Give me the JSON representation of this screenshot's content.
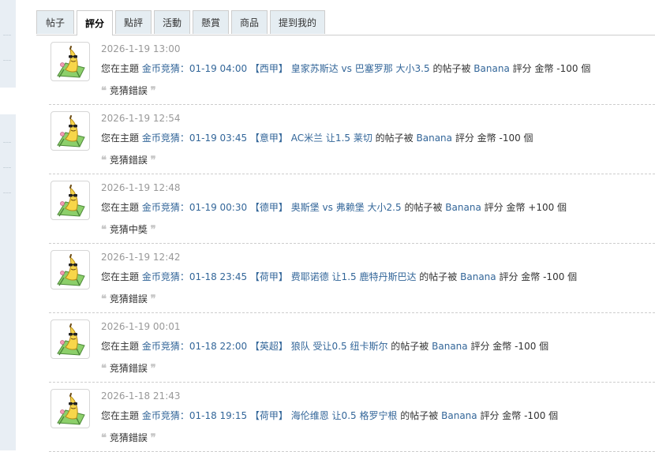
{
  "tabs": [
    {
      "label": "帖子",
      "active": false
    },
    {
      "label": "評分",
      "active": true
    },
    {
      "label": "點評",
      "active": false
    },
    {
      "label": "活動",
      "active": false
    },
    {
      "label": "懸賞",
      "active": false
    },
    {
      "label": "商品",
      "active": false
    },
    {
      "label": "提到我的",
      "active": false
    }
  ],
  "avatar_icon": "banana-sunglasses-deckchair-avatar",
  "items": [
    {
      "time": "2026-1-19 13:00",
      "prefix": "您在主題",
      "topic": "金币竞猜：01-19 04:00 【西甲】 皇家苏斯达 vs 巴塞罗那 大小3.5",
      "mid": "的帖子被",
      "user": "Banana",
      "suffix": "評分 金幣 -100 個",
      "result": "竞猜錯誤"
    },
    {
      "time": "2026-1-19 12:54",
      "prefix": "您在主題",
      "topic": "金币竞猜：01-19 03:45 【意甲】 AC米兰 让1.5 莱切",
      "mid": "的帖子被",
      "user": "Banana",
      "suffix": "評分 金幣 -100 個",
      "result": "竞猜錯誤"
    },
    {
      "time": "2026-1-19 12:48",
      "prefix": "您在主題",
      "topic": "金币竞猜：01-19 00:30 【德甲】 奥斯堡 vs 弗赖堡 大小2.5",
      "mid": "的帖子被",
      "user": "Banana",
      "suffix": "評分 金幣 +100 個",
      "result": "竞猜中獎"
    },
    {
      "time": "2026-1-19 12:42",
      "prefix": "您在主題",
      "topic": "金币竞猜：01-18 23:45 【荷甲】 费耶诺德 让1.5 鹿特丹斯巴达",
      "mid": "的帖子被",
      "user": "Banana",
      "suffix": "評分 金幣 -100 個",
      "result": "竞猜錯誤"
    },
    {
      "time": "2026-1-19 00:01",
      "prefix": "您在主題",
      "topic": "金币竞猜：01-18 22:00 【英超】 狼队 受让0.5 纽卡斯尔",
      "mid": "的帖子被",
      "user": "Banana",
      "suffix": "評分 金幣 -100 個",
      "result": "竞猜錯誤"
    },
    {
      "time": "2026-1-18 21:43",
      "prefix": "您在主題",
      "topic": "金币竞猜：01-18 19:15 【荷甲】 海伦维恩 让0.5 格罗宁根",
      "mid": "的帖子被",
      "user": "Banana",
      "suffix": "評分 金幣 -100 個",
      "result": "竞猜錯誤"
    }
  ],
  "quote_open": "❝",
  "quote_close": "❞",
  "colors": {
    "link": "#336699",
    "tab_bg": "#e5edf2",
    "muted": "#999999",
    "border": "#cdcdcd"
  }
}
